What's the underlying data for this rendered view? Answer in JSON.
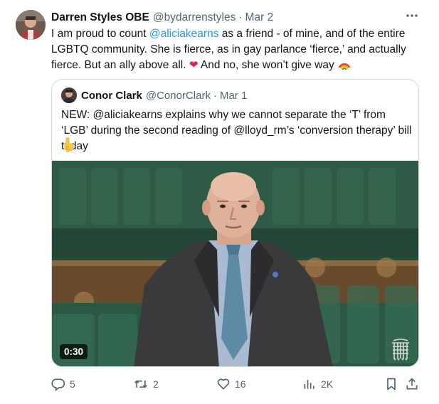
{
  "tweet": {
    "author_name": "Darren Styles OBE",
    "handle": "@bydarrenstyles",
    "separator": "·",
    "date": "Mar 2",
    "text": {
      "part1": "I am proud to count ",
      "mention": "@aliciakearns",
      "part2": " as a friend - of mine, and of the entire LGBTQ community. She is fierce, as in gay parlance ‘fierce,’ and actually fierce. But an ally above all. ",
      "heart": "❤",
      "part3": " And no, she won’t give way "
    },
    "more_icon": "more-horizontal-icon"
  },
  "quoted": {
    "author_name": "Conor Clark",
    "handle": "@ConorClark",
    "separator": "·",
    "date": "Mar 1",
    "text": "NEW: @aliciakearns explains why we cannot separate the ‘T’ from ‘LGB’ during the second reading of @lloyd_rm’s ‘conversion therapy’ bill today",
    "video_duration": "0:30"
  },
  "actions": {
    "replies": "5",
    "retweets": "2",
    "likes": "16",
    "views": "2K"
  },
  "colors": {
    "accent": "#1d9bf0",
    "muted": "#536471",
    "border": "#cfd9de",
    "heart": "#e0245e",
    "bench_green": "#2f5a45"
  }
}
